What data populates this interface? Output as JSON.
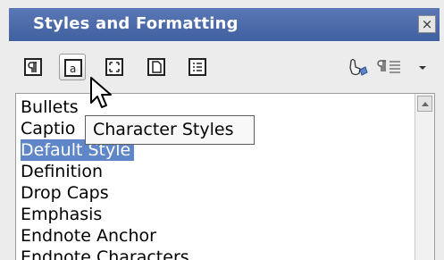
{
  "window": {
    "title": "Styles and Formatting",
    "close_symbol": "×"
  },
  "toolbar": {
    "buttons": [
      {
        "name": "paragraph-styles-icon",
        "active": false
      },
      {
        "name": "character-styles-icon",
        "active": true
      },
      {
        "name": "frame-styles-icon",
        "active": false
      },
      {
        "name": "page-styles-icon",
        "active": false
      },
      {
        "name": "list-styles-icon",
        "active": false
      }
    ],
    "right_icons": [
      "fill-format-mode-icon",
      "new-style-from-selection-icon",
      "dropdown-arrow-icon"
    ]
  },
  "style_list": {
    "items": [
      "Bullets",
      "Captio",
      "Default Style",
      "Definition",
      "Drop Caps",
      "Emphasis",
      "Endnote Anchor",
      "Endnote Characters"
    ],
    "selected": "Default Style"
  },
  "tooltip": {
    "text": "Character Styles"
  },
  "colors": {
    "title_bar": "#4a68a8",
    "selection": "#5f86c7"
  }
}
